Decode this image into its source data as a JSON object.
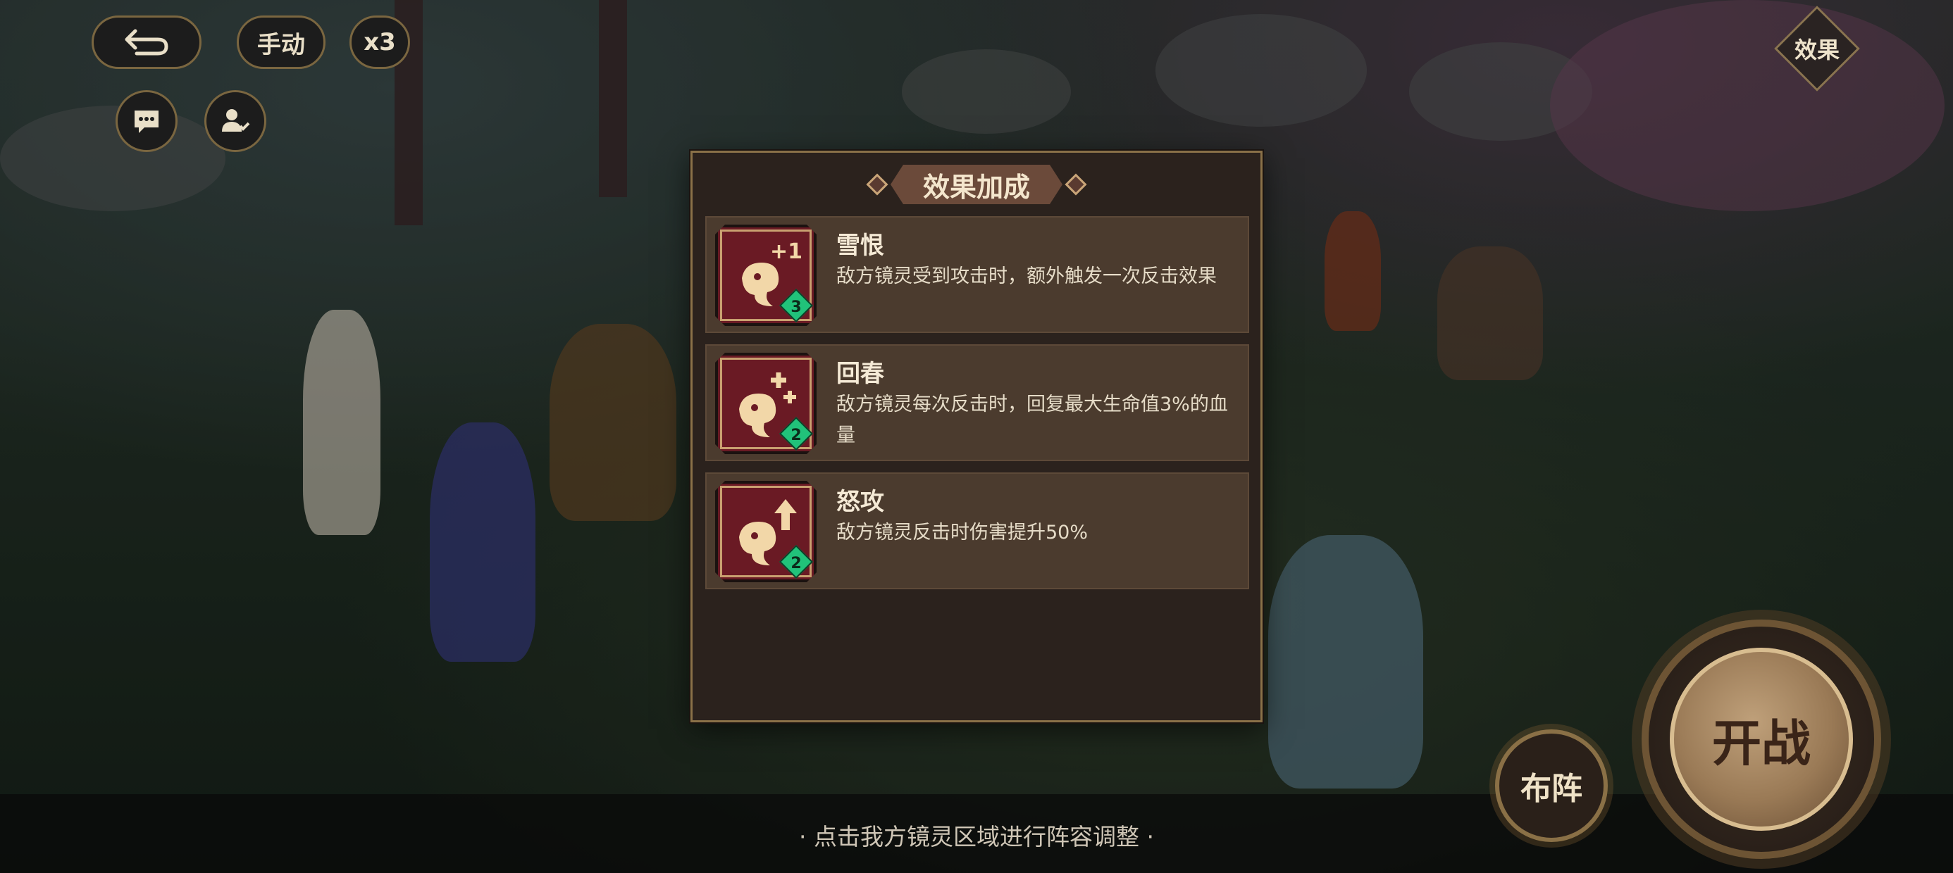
{
  "controls": {
    "back_icon": "return-arrow-icon",
    "manual_label": "手动",
    "speed_label": "x3",
    "chat_icon": "chat-bubble-icon",
    "friend_icon": "friend-user-icon",
    "effects_label": "效果"
  },
  "modal": {
    "title": "效果加成",
    "cards": [
      {
        "name": "雪恨",
        "description": "敌方镜灵受到攻击时，额外触发一次反击效果",
        "icon": "counter-plus-one-icon",
        "icon_mark": "+1",
        "level": "3"
      },
      {
        "name": "回春",
        "description": "敌方镜灵每次反击时，回复最大生命值3%的血量",
        "icon": "counter-heal-icon",
        "level": "2"
      },
      {
        "name": "怒攻",
        "description": "敌方镜灵反击时伤害提升50%",
        "icon": "counter-damage-up-icon",
        "level": "2"
      }
    ]
  },
  "hint": "· 点击我方镜灵区域进行阵容调整 ·",
  "formation_label": "布阵",
  "battle_label": "开战",
  "colors": {
    "panel_bg": "#2b221d",
    "card_bg": "#4b3b2e",
    "icon_bg": "#6a1a24",
    "badge": "#21c27a",
    "gold": "#c9a578"
  }
}
